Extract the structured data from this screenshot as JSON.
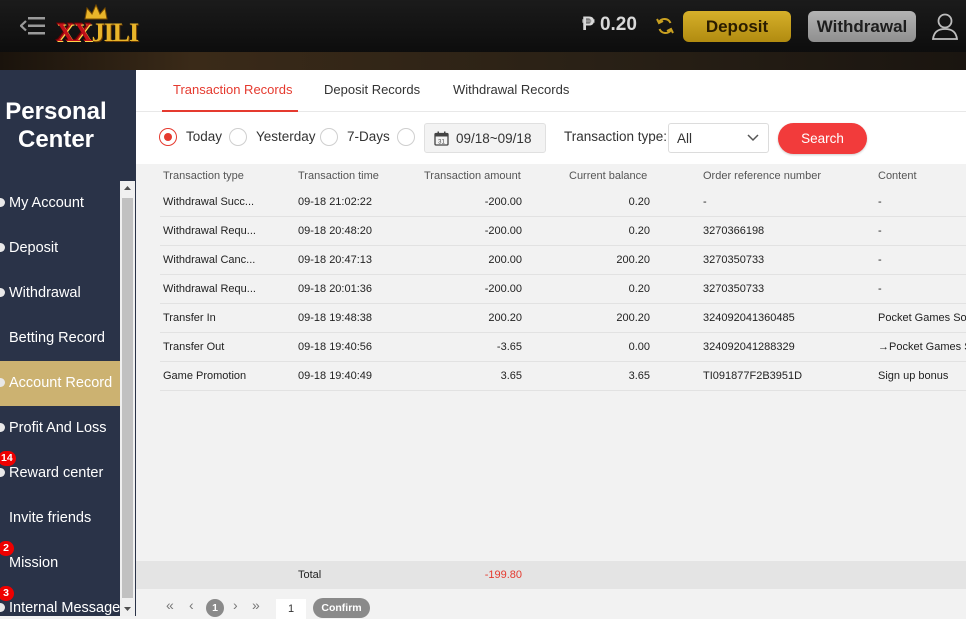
{
  "header": {
    "logo_text_a": "XX",
    "logo_text_b": "JILI",
    "balance": "₱ 0.20",
    "deposit_label": "Deposit",
    "withdrawal_label": "Withdrawal",
    "accent_gold": "#d6b02a"
  },
  "sidebar": {
    "title_line1": "Personal",
    "title_line2": "Center",
    "items": [
      {
        "label": "My Account",
        "badge": ""
      },
      {
        "label": "Deposit",
        "badge": ""
      },
      {
        "label": "Withdrawal",
        "badge": ""
      },
      {
        "label": "Betting Record",
        "badge": ""
      },
      {
        "label": "Account Record",
        "badge": "",
        "active": true
      },
      {
        "label": "Profit And Loss",
        "badge": ""
      },
      {
        "label": "Reward center",
        "badge": "14"
      },
      {
        "label": "Invite friends",
        "badge": ""
      },
      {
        "label": "Mission",
        "badge": "2"
      },
      {
        "label": "Internal Message",
        "badge": "3"
      }
    ]
  },
  "tabs": [
    {
      "label": "Transaction Records",
      "active": true
    },
    {
      "label": "Deposit Records"
    },
    {
      "label": "Withdrawal Records"
    }
  ],
  "filters": {
    "today": "Today",
    "yesterday": "Yesterday",
    "seven_days": "7-Days",
    "date_range": "09/18~09/18",
    "type_label": "Transaction type:",
    "type_value": "All",
    "search_label": "Search"
  },
  "table": {
    "headers": [
      "Transaction type",
      "Transaction time",
      "Transaction amount",
      "Current balance",
      "Order reference number",
      "Content"
    ],
    "rows": [
      [
        "Withdrawal Succ...",
        "09-18 21:02:22",
        "-200.00",
        "0.20",
        "-",
        "-"
      ],
      [
        "Withdrawal Requ...",
        "09-18 20:48:20",
        "-200.00",
        "0.20",
        "3270366198",
        "-"
      ],
      [
        "Withdrawal Canc...",
        "09-18 20:47:13",
        "200.00",
        "200.20",
        "3270350733",
        "-"
      ],
      [
        "Withdrawal Requ...",
        "09-18 20:01:36",
        "-200.00",
        "0.20",
        "3270350733",
        "-"
      ],
      [
        "Transfer In",
        "09-18 19:48:38",
        "200.20",
        "200.20",
        "324092041360485",
        "Pocket Games Soft"
      ],
      [
        "Transfer Out",
        "09-18 19:40:56",
        "-3.65",
        "0.00",
        "324092041288329",
        "→Pocket Games S"
      ],
      [
        "Game Promotion",
        "09-18 19:40:49",
        "3.65",
        "3.65",
        "TI091877F2B3951D",
        "Sign up bonus"
      ]
    ],
    "total_label": "Total",
    "total_value": "-199.80"
  },
  "pager": {
    "first": "«",
    "prev": "‹",
    "current": "1",
    "next": "›",
    "last": "»",
    "input_value": "1",
    "confirm_label": "Confirm"
  }
}
